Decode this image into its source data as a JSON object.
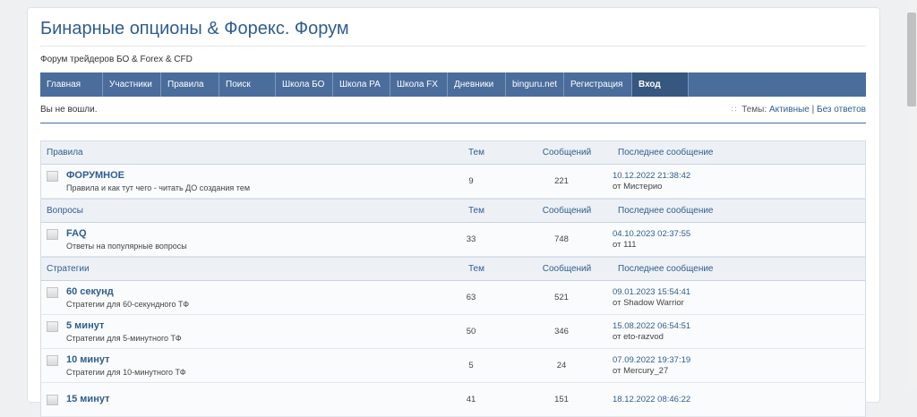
{
  "header": {
    "title": "Бинарные опционы & Форекс. Форум",
    "description": "Форум трейдеров БО & Forex & CFD"
  },
  "nav": [
    {
      "label": "Главная"
    },
    {
      "label": "Участники"
    },
    {
      "label": "Правила"
    },
    {
      "label": "Поиск"
    },
    {
      "label": "Школа БО"
    },
    {
      "label": "Школа PA"
    },
    {
      "label": "Школа FX"
    },
    {
      "label": "Дневники"
    },
    {
      "label": "binguru.net"
    },
    {
      "label": "Регистрация"
    },
    {
      "label": "Вход"
    }
  ],
  "status": {
    "not_logged": "Вы не вошли.",
    "topics_prefix": "Темы:",
    "active": "Активные",
    "separator": "|",
    "no_replies": "Без ответов"
  },
  "columns": {
    "topics": "Тем",
    "posts": "Сообщений",
    "last_post": "Последнее сообщение"
  },
  "categories": [
    {
      "name": "Правила",
      "forums": [
        {
          "name": "ФОРУМНОЕ",
          "desc": "Правила и как тут чего - читать ДО создания тем",
          "topics": "9",
          "posts": "221",
          "last_date": "10.12.2022 21:38:42",
          "last_by": "от Мистерио"
        }
      ]
    },
    {
      "name": "Вопросы",
      "forums": [
        {
          "name": "FAQ",
          "desc": "Ответы на популярные вопросы",
          "topics": "33",
          "posts": "748",
          "last_date": "04.10.2023 02:37:55",
          "last_by": "от 111"
        }
      ]
    },
    {
      "name": "Стратегии",
      "forums": [
        {
          "name": "60 секунд",
          "desc": "Стратегии для 60-секундного ТФ",
          "topics": "63",
          "posts": "521",
          "last_date": "09.01.2023 15:54:41",
          "last_by": "от Shadow Warrior"
        },
        {
          "name": "5 минут",
          "desc": "Стратегии для 5-минутного ТФ",
          "topics": "50",
          "posts": "346",
          "last_date": "15.08.2022 06:54:51",
          "last_by": "от eto-razvod"
        },
        {
          "name": "10 минут",
          "desc": "Стратегии для 10-минутного ТФ",
          "topics": "5",
          "posts": "24",
          "last_date": "07.09.2022 19:37:19",
          "last_by": "от Mercury_27"
        },
        {
          "name": "15 минут",
          "desc": "",
          "topics": "41",
          "posts": "151",
          "last_date": "18.12.2022 08:46:22",
          "last_by": ""
        }
      ]
    }
  ]
}
